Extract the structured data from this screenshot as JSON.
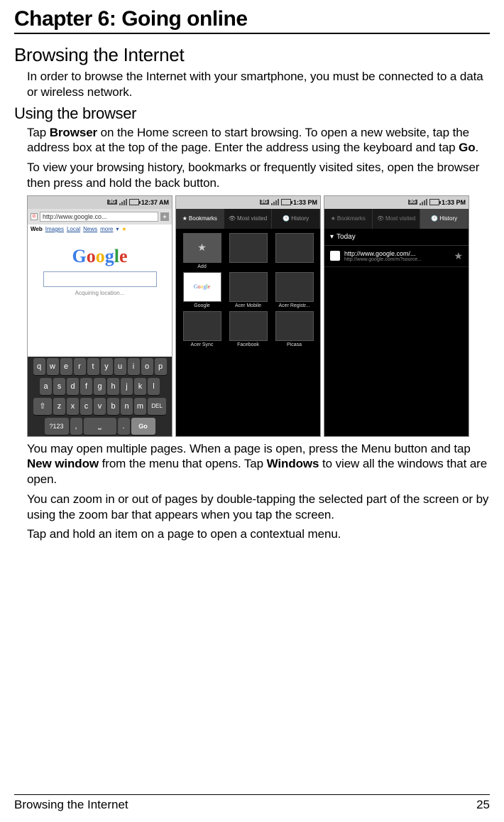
{
  "chapter_title": "Chapter 6: Going online",
  "section_title": "Browsing the Internet",
  "intro_paragraph": "In order to browse the Internet with your smartphone, you must be connected to a data or wireless network.",
  "subsection_title": "Using the browser",
  "para1_parts": {
    "pre": "Tap ",
    "bold1": "Browser",
    "mid": " on the Home screen to start browsing. To open a new website, tap the address box at the top of the page. Enter the address using the keyboard and tap ",
    "bold2": "Go",
    "post": "."
  },
  "para2": "To view your browsing history, bookmarks or frequently visited sites, open the browser then press and hold the back button.",
  "screenshot1": {
    "time": "12:37 AM",
    "url": "http://www.google.co...",
    "links": {
      "web": "Web",
      "images": "Images",
      "local": "Local",
      "news": "News",
      "more": "more"
    },
    "location_text": "Acquiring location...",
    "keyboard": {
      "row1": [
        "q",
        "w",
        "e",
        "r",
        "t",
        "y",
        "u",
        "i",
        "o",
        "p"
      ],
      "row2": [
        "a",
        "s",
        "d",
        "f",
        "g",
        "h",
        "j",
        "k",
        "l"
      ],
      "row3_shift": "⇧",
      "row3": [
        "z",
        "x",
        "c",
        "v",
        "b",
        "n",
        "m"
      ],
      "row3_del": "DEL",
      "row4_sym": "?123",
      "row4_comma": ",",
      "row4_period": ".",
      "row4_go": "Go"
    }
  },
  "screenshot2": {
    "time": "1:33 PM",
    "tabs": {
      "bookmarks": "Bookmarks",
      "most": "Most visited",
      "history": "History"
    },
    "tiles": [
      {
        "label": "Add",
        "type": "add"
      },
      {
        "label": "",
        "type": "blank"
      },
      {
        "label": "",
        "type": "blank"
      },
      {
        "label": "Google",
        "type": "google"
      },
      {
        "label": "Acer Mobile",
        "type": "site"
      },
      {
        "label": "Acer Registr...",
        "type": "site"
      },
      {
        "label": "Acer Sync",
        "type": "site"
      },
      {
        "label": "Facebook",
        "type": "site"
      },
      {
        "label": "Picasa",
        "type": "site"
      }
    ]
  },
  "screenshot3": {
    "time": "1:33 PM",
    "tabs": {
      "bookmarks": "Bookmarks",
      "most": "Most visited",
      "history": "History"
    },
    "today_label": "Today",
    "history_item": {
      "title": "http://www.google.com/...",
      "subtitle": "http://www.google.com/m?source..."
    }
  },
  "para3_parts": {
    "pre": "You may open multiple pages. When a page is open, press the Menu button and tap ",
    "bold1": "New window",
    "mid": " from the menu that opens. Tap ",
    "bold2": "Windows",
    "post": " to view all the windows that are open."
  },
  "para4": "You can zoom in or out of pages by double-tapping the selected part of the screen or by using the zoom bar that appears when you tap the screen.",
  "para5": "Tap and hold an item on a page to open a contextual menu.",
  "footer_left": "Browsing the Internet",
  "footer_right": "25"
}
